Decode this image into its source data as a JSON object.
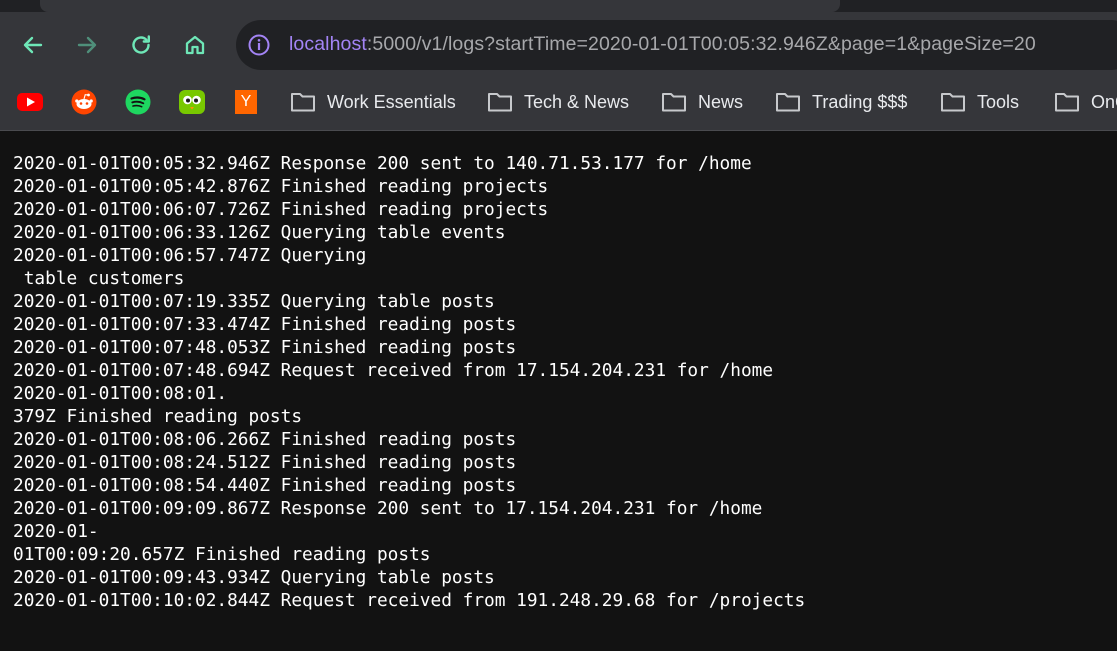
{
  "browser": {
    "address_bar": {
      "host": "localhost",
      "path": ":5000/v1/logs?startTime=2020-01-01T00:05:32.946Z&page=1&pageSize=20"
    },
    "icons": {
      "back": "arrow-left-icon",
      "forward": "arrow-right-icon",
      "reload": "reload-icon",
      "home": "home-icon",
      "site_info": "info-icon"
    },
    "colors": {
      "accent": "#6ee7b7",
      "url_host": "#a384f5",
      "url_rest": "#a7a8ab",
      "toolbar": "#35363a",
      "content_bg": "#121212"
    },
    "bookmarks": {
      "favicons": [
        {
          "name": "youtube-icon",
          "color": "#ff0000"
        },
        {
          "name": "reddit-icon",
          "color": "#ff4500"
        },
        {
          "name": "spotify-icon",
          "color": "#1ed760"
        },
        {
          "name": "duolingo-icon",
          "color": "#78c800"
        },
        {
          "name": "ycombinator-icon",
          "color": "#ff6600",
          "glyph": "Y"
        }
      ],
      "folders": [
        {
          "label": "Work Essentials"
        },
        {
          "label": "Tech & News"
        },
        {
          "label": "News"
        },
        {
          "label": "Trading $$$"
        },
        {
          "label": "Tools"
        },
        {
          "label": "OnC"
        }
      ]
    }
  },
  "log_lines": [
    "2020-01-01T00:05:32.946Z Response 200 sent to 140.71.53.177 for /home",
    "2020-01-01T00:05:42.876Z Finished reading projects",
    "2020-01-01T00:06:07.726Z Finished reading projects",
    "2020-01-01T00:06:33.126Z Querying table events",
    "2020-01-01T00:06:57.747Z Querying",
    " table customers",
    "2020-01-01T00:07:19.335Z Querying table posts",
    "2020-01-01T00:07:33.474Z Finished reading posts",
    "2020-01-01T00:07:48.053Z Finished reading posts",
    "2020-01-01T00:07:48.694Z Request received from 17.154.204.231 for /home",
    "2020-01-01T00:08:01.",
    "379Z Finished reading posts",
    "2020-01-01T00:08:06.266Z Finished reading posts",
    "2020-01-01T00:08:24.512Z Finished reading posts",
    "2020-01-01T00:08:54.440Z Finished reading posts",
    "2020-01-01T00:09:09.867Z Response 200 sent to 17.154.204.231 for /home",
    "2020-01-",
    "01T00:09:20.657Z Finished reading posts",
    "2020-01-01T00:09:43.934Z Querying table posts",
    "2020-01-01T00:10:02.844Z Request received from 191.248.29.68 for /projects"
  ]
}
